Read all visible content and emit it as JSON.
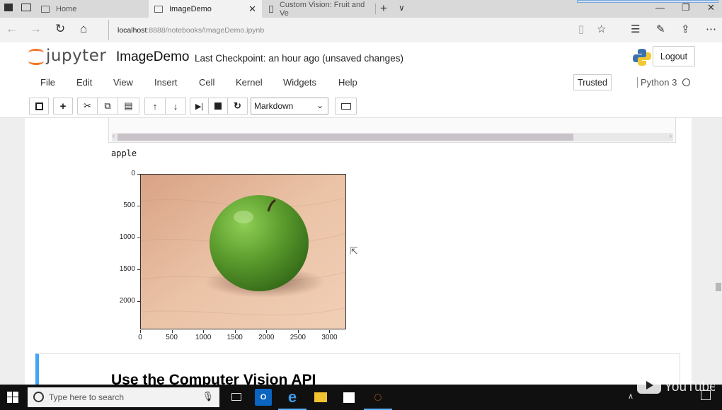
{
  "browser": {
    "tabs": [
      {
        "label": "Home",
        "active": false
      },
      {
        "label": "ImageDemo",
        "active": true
      },
      {
        "label": "Custom Vision: Fruit and Ve",
        "active": false
      }
    ],
    "url_host": "localhost",
    "url_path": ":8888/notebooks/ImageDemo.ipynb"
  },
  "jupyter": {
    "logo_text": "jupyter",
    "notebook_name": "ImageDemo",
    "checkpoint": "Last Checkpoint: an hour ago (unsaved changes)",
    "logout_label": "Logout",
    "menu": [
      "File",
      "Edit",
      "View",
      "Insert",
      "Cell",
      "Kernel",
      "Widgets",
      "Help"
    ],
    "trusted_label": "Trusted",
    "kernel_name": "Python 3",
    "cell_type": "Markdown"
  },
  "notebook": {
    "output_text": "apple",
    "markdown_heading": "Use the Computer Vision API"
  },
  "chart_data": {
    "type": "image",
    "x_ticks": [
      0,
      500,
      1000,
      1500,
      2000,
      2500,
      3000
    ],
    "y_ticks": [
      0,
      500,
      1000,
      1500,
      2000
    ],
    "xlim": [
      0,
      3264
    ],
    "ylim": [
      2448,
      0
    ]
  },
  "taskbar": {
    "search_placeholder": "Type here to search"
  },
  "overlay": {
    "watermark": "YouTube"
  },
  "colors": {
    "jupyter_orange": "#f37726",
    "cell_accent": "#42a5f5",
    "apple_green": "#5a9a2c",
    "table_wood": "#e4b598"
  }
}
